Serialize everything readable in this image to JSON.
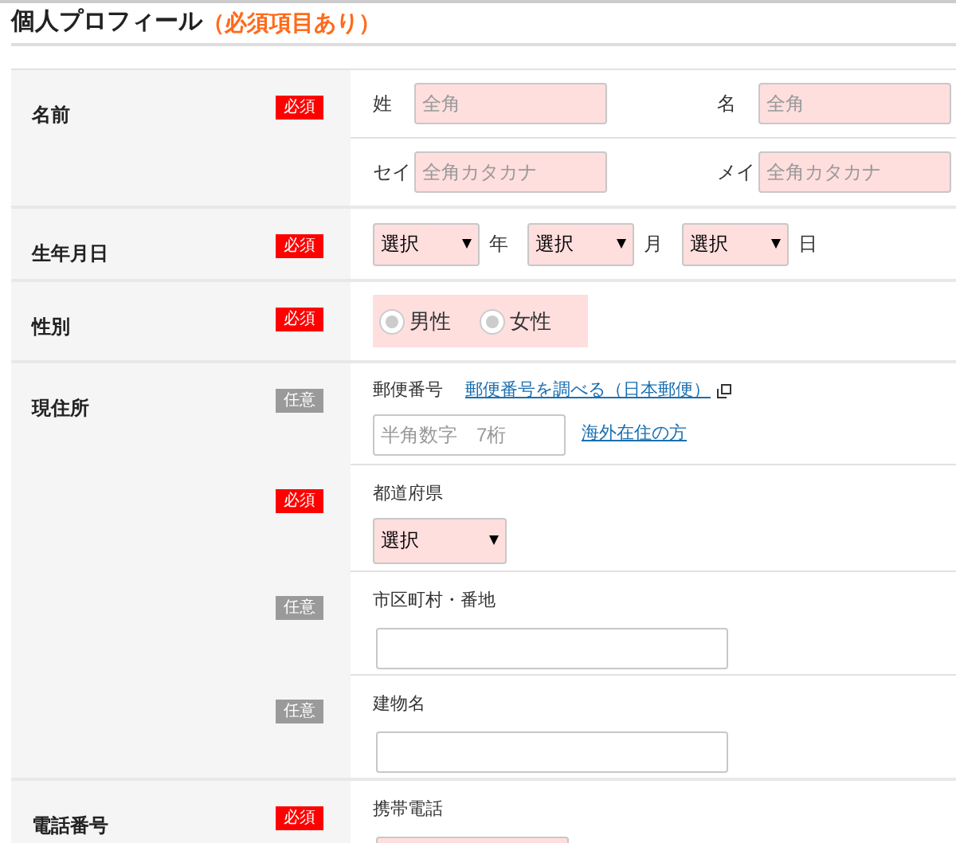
{
  "heading": {
    "title": "個人プロフィール",
    "note": "（必須項目あり）"
  },
  "sections": [
    {
      "label": "名前",
      "rows": [
        {
          "kind": "pair",
          "badge": {
            "text": "必須",
            "kind": "required"
          },
          "fields": [
            {
              "label": "姓",
              "placeholder": "全角",
              "required": true
            },
            {
              "label": "名",
              "placeholder": "全角",
              "required": true
            }
          ]
        },
        {
          "kind": "pair",
          "fields": [
            {
              "label": "セイ",
              "placeholder": "全角カタカナ",
              "required": true
            },
            {
              "label": "メイ",
              "placeholder": "全角カタカナ",
              "required": true
            }
          ]
        }
      ]
    },
    {
      "label": "生年月日",
      "rows": [
        {
          "kind": "date",
          "badge": {
            "text": "必須",
            "kind": "required"
          },
          "selects": [
            {
              "value": "選択",
              "suffix": "年"
            },
            {
              "value": "選択",
              "suffix": "月"
            },
            {
              "value": "選択",
              "suffix": "日"
            }
          ]
        }
      ]
    },
    {
      "label": "性別",
      "rows": [
        {
          "kind": "radio",
          "badge": {
            "text": "必須",
            "kind": "required"
          },
          "options": [
            {
              "label": "男性",
              "selected": false
            },
            {
              "label": "女性",
              "selected": false
            }
          ]
        }
      ]
    },
    {
      "label": "現住所",
      "rows": [
        {
          "kind": "postal",
          "badge": {
            "text": "任意",
            "kind": "optional"
          },
          "title": "郵便番号",
          "link": "郵便番号を調べる（日本郵便）",
          "placeholder": "半角数字　7桁",
          "required": false,
          "side_link": "海外在住の方"
        },
        {
          "kind": "select",
          "badge": {
            "text": "必須",
            "kind": "required"
          },
          "title": "都道府県",
          "value": "選択"
        },
        {
          "kind": "text",
          "badge": {
            "text": "任意",
            "kind": "optional"
          },
          "title": "市区町村・番地",
          "required": false
        },
        {
          "kind": "text",
          "badge": {
            "text": "任意",
            "kind": "optional"
          },
          "title": "建物名",
          "required": false
        }
      ]
    },
    {
      "label": "電話番号",
      "rows": [
        {
          "kind": "phone",
          "badge": {
            "text": "必須",
            "kind": "required"
          },
          "title": "携帯電話",
          "required": true
        }
      ]
    }
  ]
}
